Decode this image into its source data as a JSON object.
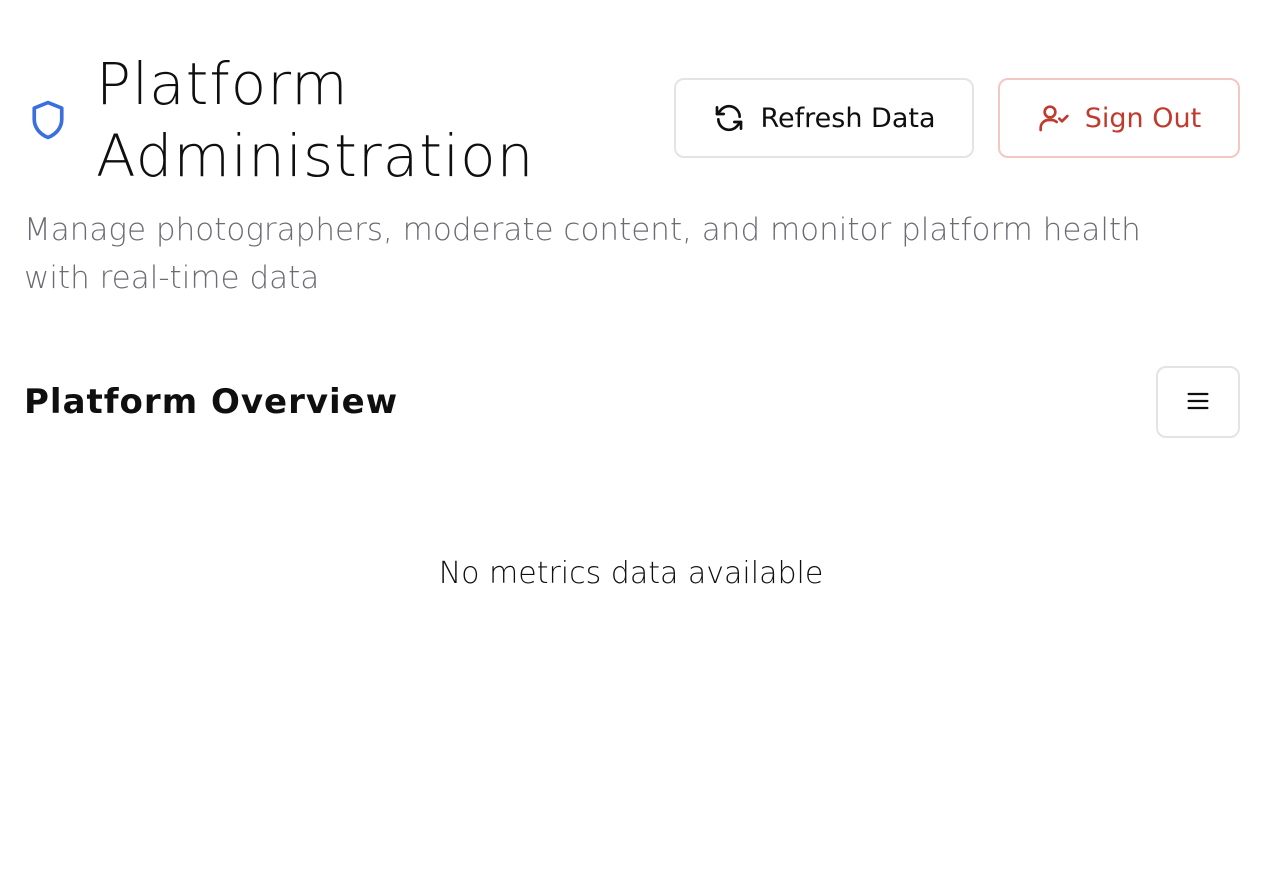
{
  "header": {
    "title": "Platform Administration",
    "icon": "shield-icon",
    "accent_color": "#3b6fe0"
  },
  "actions": {
    "refresh_label": "Refresh Data",
    "refresh_icon": "refresh-icon",
    "signout_label": "Sign Out",
    "signout_icon": "user-check-icon",
    "signout_color": "#c13a2e"
  },
  "subtitle": "Manage photographers, moderate content, and monitor platform health with real-time data",
  "overview": {
    "title": "Platform Overview",
    "menu_icon": "menu-icon",
    "empty_message": "No metrics data available"
  }
}
